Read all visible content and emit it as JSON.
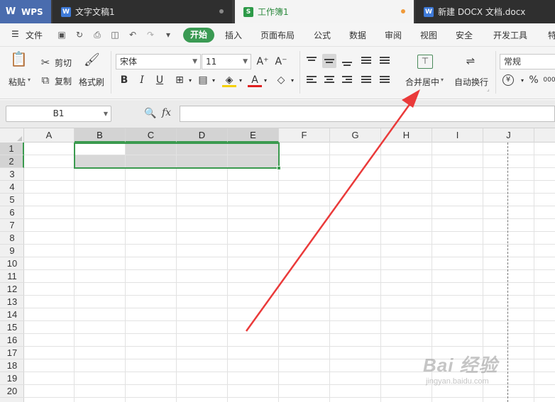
{
  "tabs": [
    {
      "label": "WPS",
      "icon": "wps-logo-icon"
    },
    {
      "label": "文字文稿1",
      "icon": "writer-doc-icon"
    },
    {
      "label": "工作簿1",
      "icon": "spreadsheet-icon"
    },
    {
      "label": "新建 DOCX 文档.docx",
      "icon": "writer-doc-icon"
    }
  ],
  "menu": {
    "file": "文件",
    "start": "开始",
    "items": [
      "插入",
      "页面布局",
      "公式",
      "数据",
      "审阅",
      "视图",
      "安全",
      "开发工具",
      "特"
    ]
  },
  "ribbon": {
    "paste": "粘贴",
    "cut": "剪切",
    "copy": "复制",
    "format_painter": "格式刷",
    "font_name": "宋体",
    "font_size": "11",
    "bold": "B",
    "italic": "I",
    "underline": "U",
    "font_color_letter": "A",
    "grow_font": "A⁺",
    "shrink_font": "A⁻",
    "merge_center": "合并居中",
    "wrap_text": "自动换行",
    "number_format": "常规",
    "currency": "¥",
    "percent": "%",
    "thousands": "000"
  },
  "formula_bar": {
    "name_box": "B1",
    "fx": "fx",
    "formula": ""
  },
  "grid": {
    "columns": [
      "A",
      "B",
      "C",
      "D",
      "E",
      "F",
      "G",
      "H",
      "I",
      "J"
    ],
    "rows": [
      "1",
      "2",
      "3",
      "4",
      "5",
      "6",
      "7",
      "8",
      "9",
      "10",
      "11",
      "12",
      "13",
      "14",
      "15",
      "16",
      "17",
      "18",
      "19",
      "20"
    ],
    "selected_range": "B1:E2",
    "active_cell": "B1"
  },
  "colors": {
    "accent_green": "#3b9a4f",
    "annotation_arrow": "#ea3a3a"
  },
  "watermark": {
    "main": "Bai 经验",
    "sub": "jingyan.baidu.com"
  }
}
